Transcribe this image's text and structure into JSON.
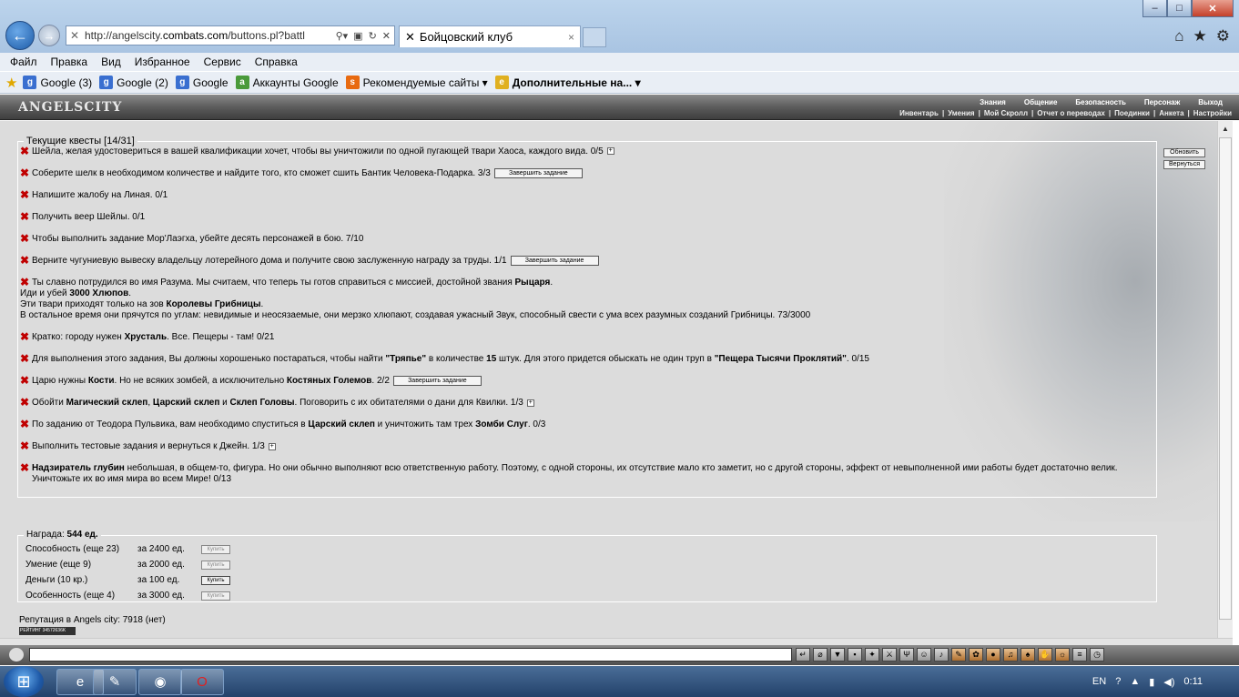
{
  "browser": {
    "url_prefix": "http://angelscity.",
    "url_domain": "combats.com",
    "url_path": "/buttons.pl?battl",
    "tab_title": "Бойцовский клуб",
    "tab_close": "×",
    "menu": [
      "Файл",
      "Правка",
      "Вид",
      "Избранное",
      "Сервис",
      "Справка"
    ],
    "favorites": [
      "Google (3)",
      "Google (2)",
      "Google",
      "Аккаунты Google",
      "Рекомендуемые сайты ▾",
      "Дополнительные на... ▾"
    ]
  },
  "game": {
    "logo": "ANGELSCITY",
    "nav": [
      "Знания",
      "Общение",
      "Безопасность",
      "Персонаж",
      "Выход"
    ],
    "subnav": [
      "Инвентарь",
      "|",
      "Умения",
      "|",
      "Мой Скролл",
      "|",
      "Отчет о переводах",
      "|",
      "Поединки",
      "|",
      "Анкета",
      "|",
      "Настройки"
    ],
    "refresh_btn": "Обновить",
    "back_btn": "Вернуться"
  },
  "quests": {
    "legend": "Текущие квесты [14/31]",
    "complete_label": "Завершить задание",
    "items": [
      {
        "text": "Шейла, желая удостовериться в вашей квалификации хочет, чтобы вы уничтожили по одной пугающей твари Хаоса, каждого вида. 0/5"
      },
      {
        "text": "Соберите шелк в необходимом количестве и найдите того, кто сможет сшить Бантик Человека-Подарка. 3/3"
      },
      {
        "text": "Напишите жалобу на Линая. 0/1"
      },
      {
        "text": "Получить веер Шейлы. 0/1"
      },
      {
        "text": "Чтобы выполнить задание Мор'Лаэгха, убейте десять персонажей в бою. 7/10"
      },
      {
        "text": "Верните чугуниевую вывеску владельцу лотерейного дома и получите свою заслуженную награду за труды. 1/1"
      },
      {
        "l1a": "Ты славно потрудился во имя Разума. Мы считаем, что теперь ты готов справиться с миссией, достойной звания ",
        "l1b": "Рыцаря",
        "l1c": ".",
        "l2a": "Иди и убей ",
        "l2b": "3000 Хлюпов",
        "l2c": ".",
        "l3a": "Эти твари приходят только на зов ",
        "l3b": "Королевы Грибницы",
        "l3c": ".",
        "l4": "В остальное время они прячутся по углам: невидимые и неосязаемые, они мерзко хлюпают, создавая ужасный Звук, способный свести с ума всех разумных созданий Грибницы. 73/3000"
      },
      {
        "a": "Кратко: городу нужен ",
        "b": "Хрусталь",
        "c": ". Все. Пещеры - там! 0/21"
      },
      {
        "a": "Для выполнения этого задания, Вы должны хорошенько постараться, чтобы найти ",
        "b": "\"Тряпье\"",
        "c": " в количестве ",
        "d": "15",
        "e": " штук. Для этого придется обыскать не один труп в ",
        "f": "\"Пещера Тысячи Проклятий\"",
        "g": ". 0/15"
      },
      {
        "a": "Царю нужны ",
        "b": "Кости",
        "c": ". Но не всяких зомбей, а исключительно ",
        "d": "Костяных Големов",
        "e": ". 2/2"
      },
      {
        "a": "Обойти ",
        "b": "Магический склеп",
        "c": ", ",
        "d": "Царский склеп",
        "e": " и ",
        "f": "Склеп Головы",
        "g": ". Поговорить с их обитателями о дани для Квилки. 1/3"
      },
      {
        "a": "По заданию от Теодора Пульвика, вам необходимо спуститься в ",
        "b": "Царский склеп",
        "c": " и уничтожить там трех ",
        "d": "Зомби Слуг",
        "e": ". 0/3"
      },
      {
        "text": "Выполнить тестовые задания и вернуться к Джейн. 1/3"
      },
      {
        "a": "Надзиратель глубин",
        "b": " небольшая, в общем-то, фигура. Но они обычно выполняют всю ответственную работу. Поэтому, с одной стороны, их отсутствие мало кто заметит, но с другой стороны, эффект от невыполненной ими работы будет достаточно велик. Уничтожьте их во имя мира во всем Мире! 0/13"
      }
    ]
  },
  "reward": {
    "legend_a": "Награда: ",
    "legend_b": "544 ед.",
    "buy_label": "Купить",
    "rows": [
      {
        "name": "Способность (еще 23)",
        "price": "за 2400 ед."
      },
      {
        "name": "Умение (еще 9)",
        "price": "за 2000 ед."
      },
      {
        "name": "Деньги (10 кр.)",
        "price": "за 100 ед."
      },
      {
        "name": "Особенность (еще 4)",
        "price": "за 3000 ед."
      }
    ]
  },
  "reputation": "Репутация в Angels city: 7918 (нет)",
  "counter": "РЕЙТИНГ 34572636K",
  "taskbar": {
    "lang": "EN",
    "time": "0:11"
  }
}
